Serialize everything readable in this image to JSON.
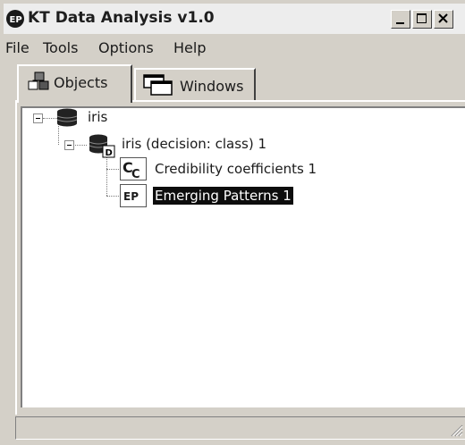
{
  "window": {
    "title": "KT Data Analysis v1.0",
    "controls": {
      "minimize": "minimize",
      "maximize": "maximize",
      "close": "close"
    }
  },
  "menu": {
    "items": [
      {
        "label": "File"
      },
      {
        "label": "Tools"
      },
      {
        "label": "Options"
      },
      {
        "label": "Help"
      }
    ]
  },
  "tabs": [
    {
      "label": "Objects",
      "icon": "objects-icon",
      "active": true
    },
    {
      "label": "Windows",
      "icon": "windows-icon",
      "active": false
    }
  ],
  "tree": {
    "nodes": [
      {
        "label": "iris",
        "icon": "database-icon",
        "expanded": true
      },
      {
        "label": "iris (decision: class) 1",
        "icon": "decision-database-icon",
        "badge": "D",
        "expanded": true
      },
      {
        "label": "Credibility coefficients 1",
        "icon": "credibility-coefficients-icon",
        "badge": "CC"
      },
      {
        "label": "Emerging Patterns 1",
        "icon": "emerging-patterns-icon",
        "badge": "EP",
        "selected": true
      }
    ]
  },
  "status": {
    "text": ""
  },
  "colors": {
    "face": "#d4d0c8",
    "selection": "#0d0d0d",
    "tree_bg": "#ffffff"
  }
}
